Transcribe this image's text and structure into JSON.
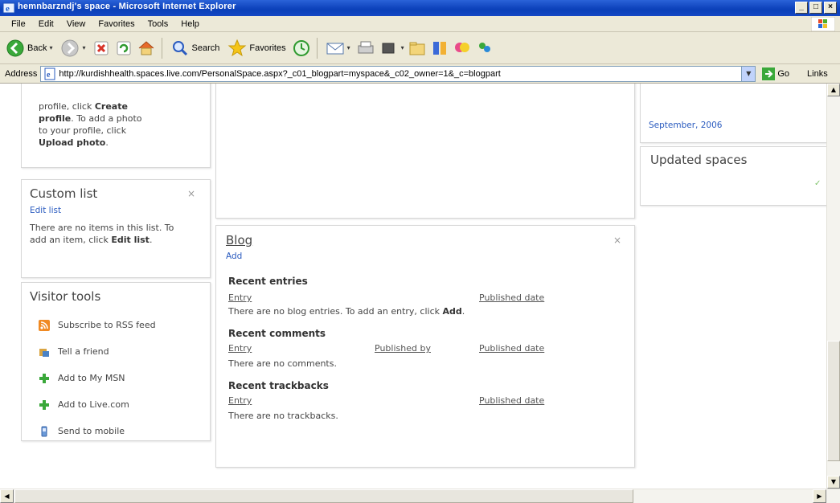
{
  "window": {
    "title": "hemnbarzndj's space - Microsoft Internet Explorer",
    "buttons": [
      "_",
      "□",
      "×"
    ]
  },
  "menu": [
    "File",
    "Edit",
    "View",
    "Favorites",
    "Tools",
    "Help"
  ],
  "toolbar": {
    "back": "Back",
    "search": "Search",
    "favorites": "Favorites"
  },
  "address": {
    "label": "Address",
    "url": "http://kurdishhealth.spaces.live.com/PersonalSpace.aspx?_c01_blogpart=myspace&_c02_owner=1&_c=blogpart",
    "go": "Go",
    "links": "Links"
  },
  "profile": {
    "line1_prefix": "profile, click ",
    "line1_bold": "Create",
    "line2_bold": "profile",
    "line2_rest": ". To add a photo",
    "line3": "to your profile, click",
    "line4_bold": "Upload photo",
    "line4_rest": "."
  },
  "custom_list": {
    "title": "Custom list",
    "edit": "Edit list",
    "text": "There are no items in this list. To add an item, click",
    "bold": "Edit list",
    "end": "."
  },
  "visitor_tools": {
    "title": "Visitor tools",
    "items": [
      {
        "label": "Subscribe to RSS feed",
        "icon": "rss-icon"
      },
      {
        "label": "Tell a friend",
        "icon": "people-icon"
      },
      {
        "label": "Add to My MSN",
        "icon": "plus-icon"
      },
      {
        "label": "Add to Live.com",
        "icon": "plus-icon"
      },
      {
        "label": "Send to mobile",
        "icon": "mobile-icon"
      }
    ]
  },
  "right": {
    "date": "September, 2006",
    "updated": "Updated spaces"
  },
  "blog": {
    "title": "Blog",
    "add": "Add",
    "recent_entries": "Recent entries",
    "entry": "Entry",
    "published_date": "Published date",
    "published_by": "Published by",
    "no_entries": "There are no blog entries. To add an entry, click",
    "no_entries_bold": "Add",
    "no_entries_end": ".",
    "recent_comments": "Recent comments",
    "no_comments": "There are no comments.",
    "recent_trackbacks": "Recent trackbacks",
    "no_trackbacks": "There are no trackbacks."
  },
  "close_glyph": "×"
}
